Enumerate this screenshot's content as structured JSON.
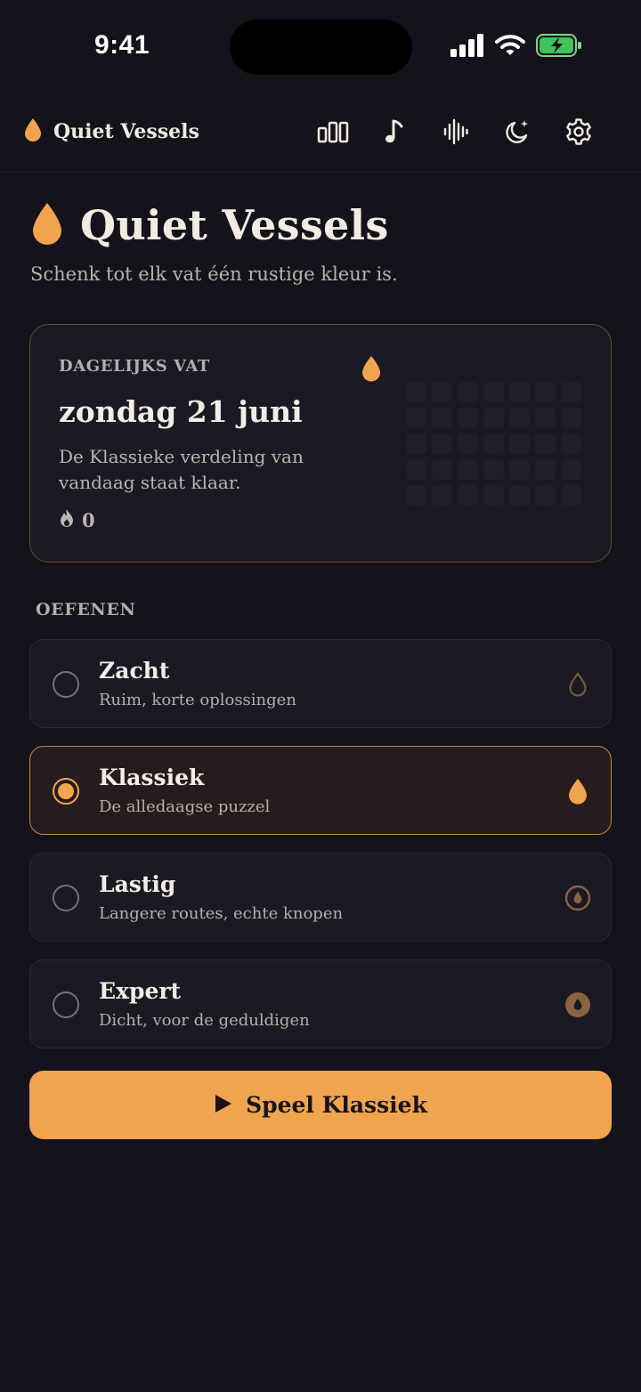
{
  "status_bar": {
    "time": "9:41",
    "icons": [
      "signal-icon",
      "wifi-icon",
      "battery-charging-icon"
    ]
  },
  "app": {
    "name": "Quiet Vessels",
    "brand_icon": "droplet-icon",
    "accent_color": "#f1a44f",
    "toolbar_icons": [
      "stats-icon",
      "music-icon",
      "soundwave-icon",
      "night-mode-icon",
      "settings-icon"
    ]
  },
  "hero": {
    "title": "Quiet Vessels",
    "subtitle": "Schenk tot elk vat één rustige kleur is."
  },
  "daily": {
    "label": "DAGELIJKS VAT",
    "date": "zondag 21 juni",
    "description": "De Klassieke verdeling van vandaag staat klaar.",
    "streak": "0",
    "streak_icon": "flame-icon"
  },
  "practice": {
    "label": "OEFENEN",
    "modes": [
      {
        "title": "Zacht",
        "subtitle": "Ruim, korte oplossingen",
        "icon": "droplet-outline-icon",
        "selected": false
      },
      {
        "title": "Klassiek",
        "subtitle": "De alledaagse puzzel",
        "icon": "droplet-icon",
        "selected": true
      },
      {
        "title": "Lastig",
        "subtitle": "Langere routes, echte knopen",
        "icon": "droplet-circle-icon",
        "selected": false
      },
      {
        "title": "Expert",
        "subtitle": "Dicht, voor de geduldigen",
        "icon": "droplet-filled-circle-icon",
        "selected": false
      }
    ]
  },
  "play_button": {
    "label": "Speel Klassiek",
    "icon": "play-icon"
  }
}
